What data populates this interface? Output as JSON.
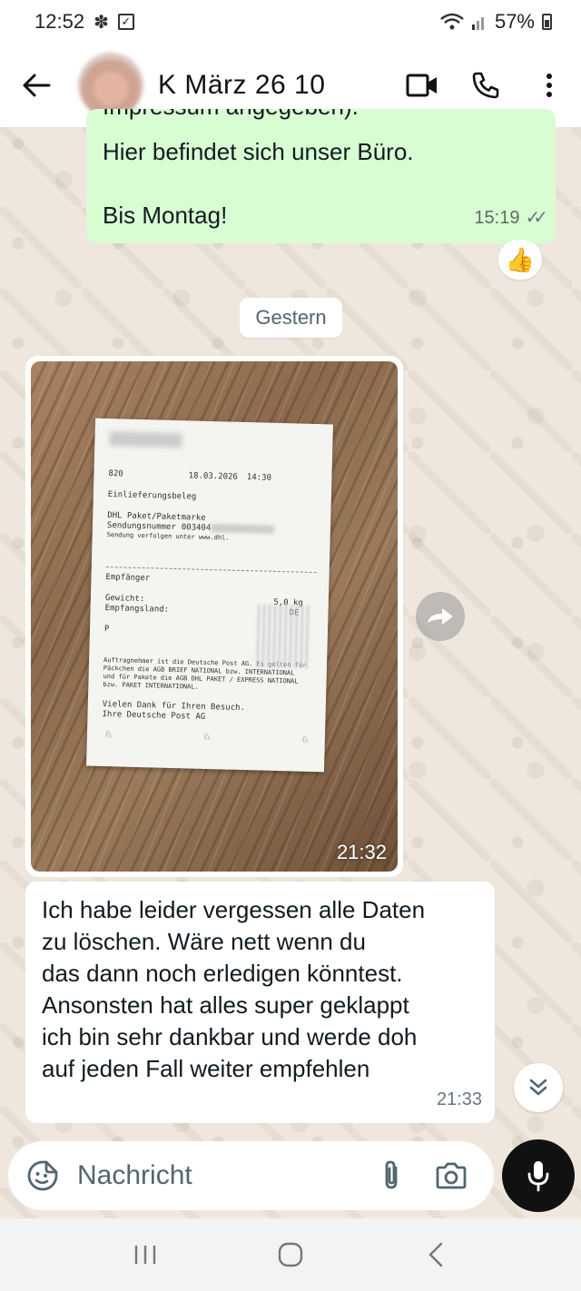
{
  "status_bar": {
    "time": "12:52",
    "battery": "57%"
  },
  "header": {
    "contact_name": "K März 26 10"
  },
  "messages": {
    "outgoing": {
      "partial_text": "Impressum angegeben).",
      "line1": "Hier befindet sich unser Büro.",
      "line2": "Bis Montag!",
      "time": "15:19",
      "ticks": "✓✓",
      "reaction": "👍"
    },
    "date_chip": "Gestern",
    "image": {
      "time": "21:32",
      "receipt": {
        "code": "820",
        "date": "18.03.2026",
        "clock": "14:30",
        "title": "Einlieferungsbeleg",
        "product": "DHL Paket/Paketmarke",
        "tracking_label": "Sendungsnummer",
        "tracking_value": "003404",
        "follow": "Sendung verfolgen unter www.dhl.",
        "recipient": "Empfänger",
        "weight_label": "Gewicht:",
        "weight_value": "5,0 kg",
        "country_label": "Empfangsland:",
        "country_value": "DE",
        "p_label": "P",
        "terms": [
          "Auftragnehmer ist die Deutsche Post AG. Es gelten für",
          "Päckchen die AGB BRIEF NATIONAL bzw. INTERNATIONAL",
          "und für Pakete die AGB DHL PAKET / EXPRESS NATIONAL",
          "bzw. PAKET INTERNATIONAL."
        ],
        "thanks1": "Vielen Dank für Ihren Besuch.",
        "thanks2": "Ihre Deutsche Post AG"
      }
    },
    "incoming": {
      "lines": [
        "Ich habe leider vergessen alle Daten",
        "zu löschen. Wäre nett wenn du",
        "das dann noch erledigen könntest.",
        "Ansonsten hat alles super geklappt",
        "ich bin sehr dankbar und werde doh",
        "auf jeden Fall weiter empfehlen"
      ],
      "time": "21:33"
    }
  },
  "composer": {
    "placeholder": "Nachricht"
  },
  "colors": {
    "outgoing_bubble": "#d9fdd3",
    "incoming_bubble": "#ffffff",
    "mic_button": "#111111"
  },
  "icons": [
    "back-arrow-icon",
    "video-call-icon",
    "phone-icon",
    "more-vert-icon",
    "forward-icon",
    "double-chevron-down-icon",
    "sticker-icon",
    "attach-icon",
    "camera-icon",
    "mic-icon"
  ]
}
